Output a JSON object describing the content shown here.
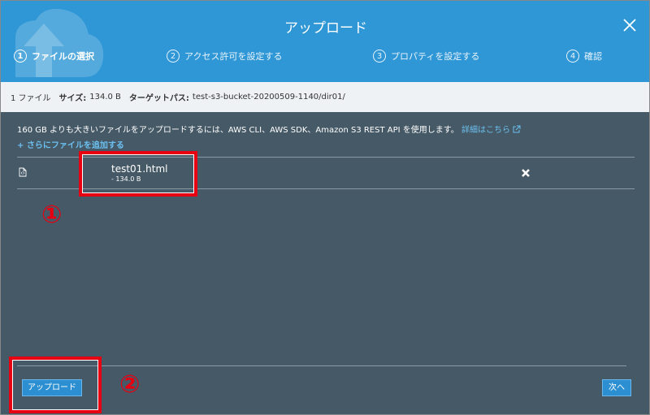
{
  "dialog": {
    "title": "アップロード"
  },
  "steps": [
    {
      "num": "1",
      "label": "ファイルの選択",
      "active": true
    },
    {
      "num": "2",
      "label": "アクセス許可を設定する",
      "active": false
    },
    {
      "num": "3",
      "label": "プロパティを設定する",
      "active": false
    },
    {
      "num": "4",
      "label": "確認",
      "active": false
    }
  ],
  "infobar": {
    "count": "1 ファイル",
    "size_label": "サイズ:",
    "size_value": "134.0 B",
    "target_label": "ターゲットパス:",
    "target_value": "test-s3-bucket-20200509-1140/dir01/"
  },
  "notice": {
    "text": "160 GB よりも大きいファイルをアップロードするには、AWS CLI、AWS SDK、Amazon S3 REST API を使用します。",
    "link": "詳細はこちら"
  },
  "add_more": "さらにファイルを追加する",
  "files": [
    {
      "name": "test01.html",
      "size": "- 134.0 B"
    }
  ],
  "annotations": {
    "one": "①",
    "two": "②"
  },
  "buttons": {
    "upload": "アップロード",
    "next": "次へ"
  },
  "colors": {
    "header": "#2f97d6",
    "body": "#465966",
    "accent": "#e60012",
    "link": "#6cc0f0"
  }
}
